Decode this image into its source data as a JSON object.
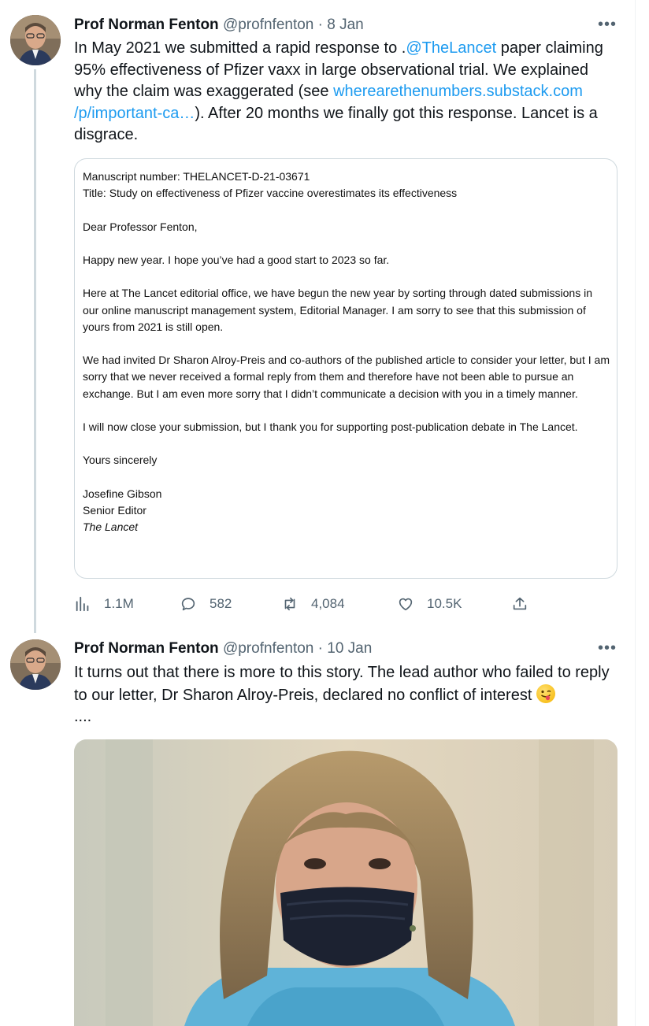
{
  "tweets": [
    {
      "author_name": "Prof Norman Fenton",
      "author_handle": "@profnfenton",
      "separator": "·",
      "date": "8 Jan",
      "more": "•••",
      "text_1": "In May 2021 we submitted a rapid response to .",
      "mention": "@TheLancet",
      "text_2": " paper claiming 95% effectiveness of Pfizer vaxx in large observational trial. We explained why the claim was exaggerated (see ",
      "link_line1": "wherearethenumbers.substack.com",
      "link_line2": "/p/important-ca…",
      "text_3": "). After 20 months we finally got this response. Lancet is a disgrace.",
      "letter": {
        "manuscript": "Manuscript number: THELANCET-D-21-03671",
        "title": "Title: Study on effectiveness of Pfizer vaccine overestimates its effectiveness",
        "salutation": "Dear Professor Fenton,",
        "p1": "Happy new year. I hope you’ve had a good start to 2023 so far.",
        "p2": "Here at The Lancet editorial office, we have begun the new year by sorting through dated submissions in our online manuscript management system, Editorial Manager. I am sorry to see that this submission of yours from 2021 is still open.",
        "p3": "We had invited Dr Sharon Alroy-Preis and co-authors of the published article to consider your letter, but I am sorry that we never received a formal reply from them and therefore have not been able to pursue an exchange. But I am even more sorry that I didn’t communicate a decision with you in a timely manner.",
        "p4": "I will now close your submission, but I thank you for supporting post-publication debate in The Lancet.",
        "closing": "Yours sincerely",
        "signer": "Josefine Gibson",
        "role": "Senior Editor",
        "journal": "The Lancet"
      },
      "stats": {
        "views": "1.1M",
        "replies": "582",
        "retweets": "4,084",
        "likes": "10.5K"
      }
    },
    {
      "author_name": "Prof Norman Fenton",
      "author_handle": "@profnfenton",
      "separator": "·",
      "date": "10 Jan",
      "more": "•••",
      "text": "It turns out that there is more to this story. The lead author who failed to reply to our letter, Dr Sharon Alroy-Preis, declared no conflict of interest",
      "text_tail": "....",
      "emoji": "winking-face-with-tongue"
    }
  ],
  "colors": {
    "link": "#1d9bf0",
    "secondary": "#536471",
    "thread": "#cfd9de"
  }
}
